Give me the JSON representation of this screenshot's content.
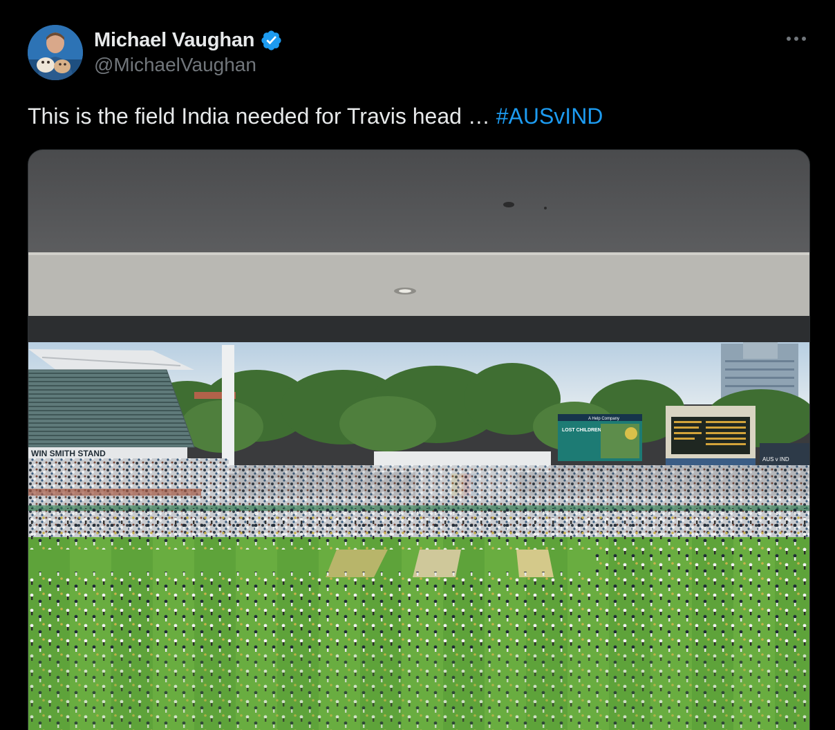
{
  "author": {
    "display_name": "Michael Vaughan",
    "handle": "@MichaelVaughan",
    "verified": true,
    "avatar_icon": "profile-photo"
  },
  "tweet": {
    "text": "This is the field India needed for Travis head … ",
    "hashtag": "#AUSvIND"
  },
  "photo": {
    "stand_sign": "WIN SMITH STAND",
    "screen_company": "A Help Company",
    "screen_heading": "LOST CHILDREN",
    "scoreboard_text": "AUS v IND"
  },
  "colors": {
    "background": "#000000",
    "text_primary": "#e7e9ea",
    "text_secondary": "#71767b",
    "link": "#1d9bf0",
    "verified_badge": "#1d9bf0",
    "grass": "#5fa33a"
  },
  "icons": {
    "verified": "verified-badge-icon",
    "more": "more-options-icon"
  }
}
